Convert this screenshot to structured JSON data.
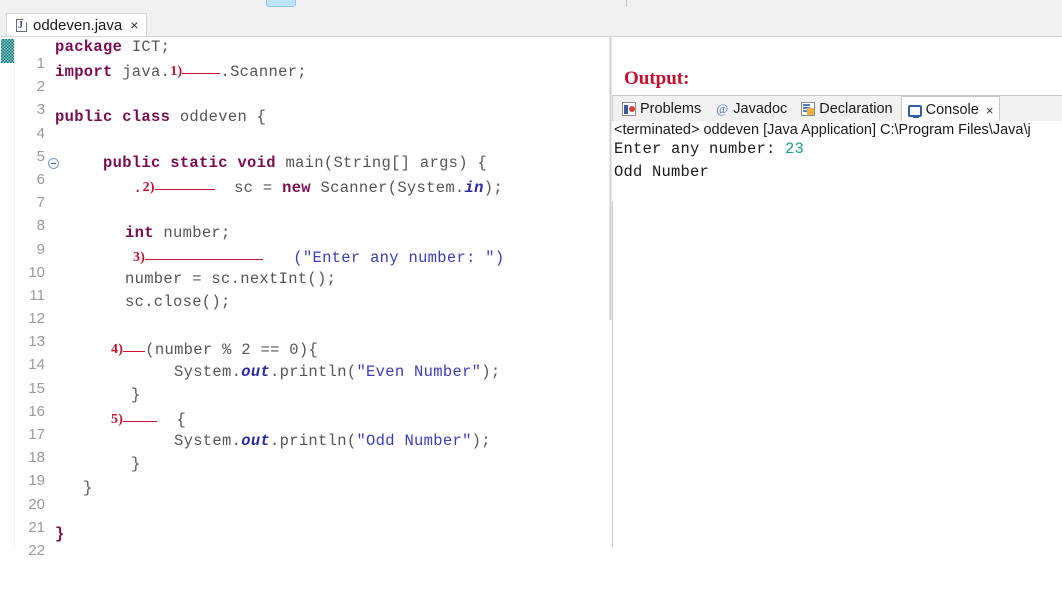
{
  "window": {
    "toolbar_chip": "toolbar-button-highlight"
  },
  "editor_tab": {
    "icon": "java-file-icon",
    "label": "oddeven.java",
    "close": "×"
  },
  "editor": {
    "marker": "occurrence-marker-block",
    "fold_icon": "collapse-minus-icon",
    "lines": [
      {
        "n": "1",
        "fold": false
      },
      {
        "n": "2",
        "fold": false
      },
      {
        "n": "3",
        "fold": false
      },
      {
        "n": "4",
        "fold": false
      },
      {
        "n": "5",
        "fold": false
      },
      {
        "n": "6",
        "fold": true
      },
      {
        "n": "7",
        "fold": false
      },
      {
        "n": "8",
        "fold": false
      },
      {
        "n": "9",
        "fold": false
      },
      {
        "n": "10",
        "fold": false
      },
      {
        "n": "11",
        "fold": false
      },
      {
        "n": "12",
        "fold": false
      },
      {
        "n": "13",
        "fold": false
      },
      {
        "n": "14",
        "fold": false
      },
      {
        "n": "15",
        "fold": false
      },
      {
        "n": "16",
        "fold": false
      },
      {
        "n": "17",
        "fold": false
      },
      {
        "n": "18",
        "fold": false
      },
      {
        "n": "19",
        "fold": false
      },
      {
        "n": "20",
        "fold": false
      },
      {
        "n": "21",
        "fold": false
      },
      {
        "n": "22",
        "fold": false
      }
    ],
    "line_numbers": {
      "1": "1",
      "2": "2",
      "3": "3",
      "4": "4",
      "5": "5",
      "6": "6",
      "7": "7",
      "8": "8",
      "9": "9",
      "10": "10",
      "11": "11",
      "12": "12",
      "13": "13",
      "14": "14",
      "15": "15",
      "16": "16",
      "17": "17",
      "18": "18",
      "19": "19",
      "20": "20",
      "21": "21",
      "22": "22"
    },
    "code": {
      "l1_kw": "package",
      "l1_rest": " ICT;",
      "l2_kw": "import",
      "l2_mid": " java.",
      "l2_blanknum": "1)",
      "l2_tail": ".Scanner;",
      "l4_kw1": "public",
      "l4_kw2": "class",
      "l4_rest": " oddeven {",
      "l6_kw1": "public",
      "l6_kw2": "static",
      "l6_kw3": "void",
      "l6_rest": " main(String[] args) {",
      "l7_dot": ".",
      "l7_blanknum": "2)",
      "l7_mid": "  sc = ",
      "l7_kw": "new",
      "l7_tail1": " Scanner(System.",
      "l7_field": "in",
      "l7_tail2": ");",
      "l9_kw": "int",
      "l9_rest": " number;",
      "l10_blanknum": "3)",
      "l10_str": "(\"Enter any number: \")",
      "l11": "number = sc.nextInt();",
      "l12": "sc.close();",
      "l14_blanknum": "4)",
      "l14_rest": "(number % 2 == 0){",
      "l15_pre": "System.",
      "l15_field": "out",
      "l15_mid": ".println(",
      "l15_str": "\"Even Number\"",
      "l15_tail": ");",
      "l16": "}",
      "l17_blanknum": "5)",
      "l17_rest": "  {",
      "l18_pre": "System.",
      "l18_field": "out",
      "l18_mid": ".println(",
      "l18_str": "\"Odd Number\"",
      "l18_tail": ");",
      "l19": "}",
      "l20": "}",
      "l22": "}"
    }
  },
  "output": {
    "caption": "Output:",
    "tabs": [
      {
        "label": "Problems",
        "icon": "problems-icon",
        "active": false
      },
      {
        "label": "Javadoc",
        "icon": "javadoc-icon",
        "active": false
      },
      {
        "label": "Declaration",
        "icon": "declaration-icon",
        "active": false
      },
      {
        "label": "Console",
        "icon": "console-icon",
        "active": true
      }
    ],
    "tab_close": "×",
    "process_line": "<terminated> oddeven [Java Application] C:\\Program Files\\Java\\j",
    "console_lines": [
      {
        "prompt": "Enter any number: ",
        "input": "23"
      },
      {
        "prompt": "Odd Number",
        "input": ""
      }
    ]
  },
  "colors": {
    "keyword": "#7a0c52",
    "string": "#3b3bbf",
    "blank_red": "#c8102e",
    "caption_red": "#c8102e",
    "console_input": "#1a9e8f",
    "field_blue": "#2a2aa8"
  }
}
